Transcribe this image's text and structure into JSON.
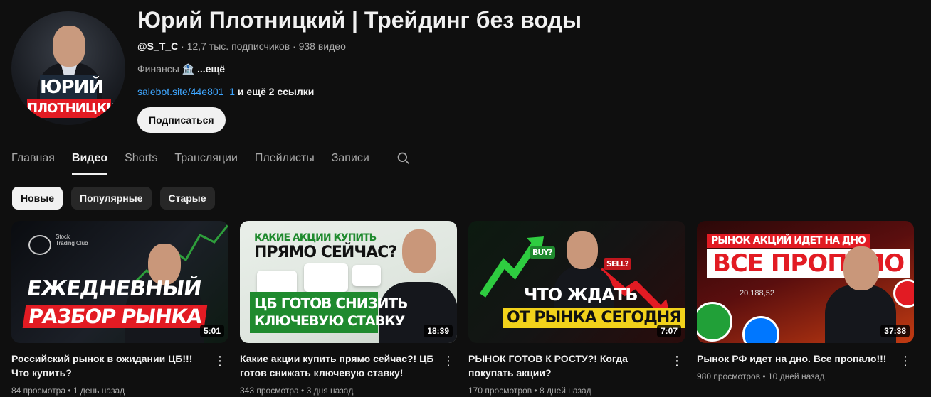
{
  "channel": {
    "title": "Юрий Плотницкий | Трейдинг без воды",
    "handle": "@S_T_C",
    "stats": " · 12,7 тыс. подписчиков · 938 видео",
    "description": "Финансы 🏦 ",
    "description_more": "...ещё",
    "link": "salebot.site/44e801_1",
    "more_links": " и ещё 2 ссылки",
    "subscribe_label": "Подписаться",
    "avatar_text_line1": "ЮРИЙ",
    "avatar_text_line2": "ПЛОТНИЦКИЙ"
  },
  "tabs": [
    "Главная",
    "Видео",
    "Shorts",
    "Трансляции",
    "Плейлисты",
    "Записи"
  ],
  "active_tab": "Видео",
  "chips": [
    "Новые",
    "Популярные",
    "Старые"
  ],
  "videos": [
    {
      "title": "Российский рынок в ожидании ЦБ!!! Что купить?",
      "meta": "84 просмотра • 1 день назад",
      "duration": "5:01",
      "thumb_text1": "ЕЖЕДНЕВНЫЙ",
      "thumb_text2": "РАЗБОР РЫНКА",
      "thumb_logo": "Stock Trading Club"
    },
    {
      "title": "Какие акции купить прямо сейчас?! ЦБ готов снижать ключевую ставку!",
      "meta": "343 просмотра • 3 дня назад",
      "duration": "18:39",
      "thumb_text1": "КАКИЕ АКЦИИ КУПИТЬ",
      "thumb_text2": "ПРЯМО СЕЙЧАС?",
      "thumb_text3": "ЦБ ГОТОВ СНИЗИТЬ",
      "thumb_text4": "КЛЮЧЕВУЮ СТАВКУ"
    },
    {
      "title": "РЫНОК ГОТОВ К РОСТУ?! Когда покупать акции?",
      "meta": "170 просмотров • 8 дней назад",
      "duration": "7:07",
      "thumb_text1": "ЧТО ЖДАТЬ",
      "thumb_text2": "ОТ РЫНКА СЕГОДНЯ",
      "thumb_buy": "BUY?",
      "thumb_sell": "SELL?"
    },
    {
      "title": "Рынок РФ идет на дно. Все пропало!!!",
      "meta": "980 просмотров • 10 дней назад",
      "duration": "37:38",
      "thumb_text1": "РЫНОК АКЦИЙ ИДЕТ НА ДНО",
      "thumb_text2": "ВСЕ ПРОПАЛО",
      "thumb_number": "20.188,52"
    }
  ],
  "colors": {
    "background": "#0f0f0f",
    "text": "#f1f1f1",
    "secondary_text": "#aaaaaa",
    "link": "#3ea6ff",
    "accent_red": "#e21b23",
    "accent_green": "#2e9e3b",
    "accent_yellow": "#f2d21b"
  }
}
